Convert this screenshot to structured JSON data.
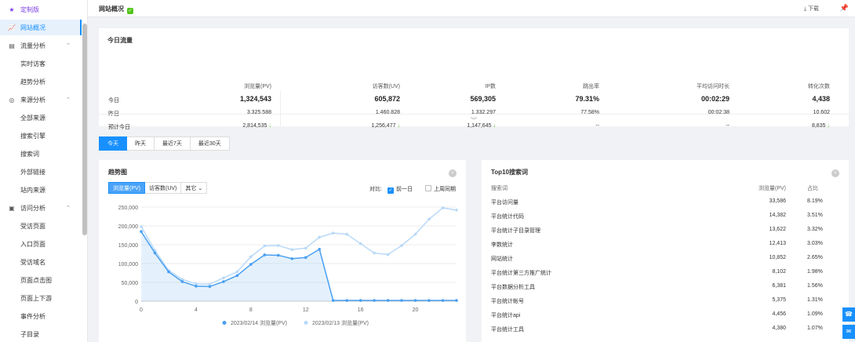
{
  "sidebar": {
    "custom": "定制版",
    "items": [
      {
        "label": "网站概况",
        "icon": "line-chart-icon",
        "type": "top",
        "active": true
      },
      {
        "label": "流量分析",
        "icon": "traffic-icon",
        "type": "group"
      },
      {
        "label": "实时访客",
        "type": "sub"
      },
      {
        "label": "趋势分析",
        "type": "sub"
      },
      {
        "label": "来源分析",
        "icon": "source-icon",
        "type": "group"
      },
      {
        "label": "全部来源",
        "type": "sub"
      },
      {
        "label": "搜索引擎",
        "type": "sub"
      },
      {
        "label": "搜索词",
        "type": "sub"
      },
      {
        "label": "外部链接",
        "type": "sub"
      },
      {
        "label": "站内来源",
        "type": "sub"
      },
      {
        "label": "访问分析",
        "icon": "visit-icon",
        "type": "group"
      },
      {
        "label": "受访页面",
        "type": "sub"
      },
      {
        "label": "入口页面",
        "type": "sub"
      },
      {
        "label": "受访域名",
        "type": "sub"
      },
      {
        "label": "页面点击图",
        "type": "sub"
      },
      {
        "label": "页面上下游",
        "type": "sub"
      },
      {
        "label": "事件分析",
        "type": "sub"
      },
      {
        "label": "子目录",
        "type": "sub"
      }
    ]
  },
  "header": {
    "title": "网站概况",
    "download": "下载"
  },
  "traffic": {
    "title": "今日流量",
    "columns": [
      "浏览量(PV)",
      "访客数(UV)",
      "IP数",
      "跳出率",
      "平均访问时长",
      "转化次数"
    ],
    "rows": [
      {
        "label": "今日",
        "values": [
          "1,324,543",
          "605,872",
          "569,305",
          "79.31%",
          "00:02:29",
          "4,438"
        ]
      },
      {
        "label": "昨日",
        "values": [
          "3,325,588",
          "1,460,828",
          "1,332,297",
          "77.58%",
          "00:02:38",
          "10,602"
        ]
      },
      {
        "label": "预计今日",
        "values": [
          "2,814,535",
          "1,256,477",
          "1,147,645",
          "--",
          "--",
          "8,835"
        ]
      }
    ]
  },
  "tabs": [
    "今天",
    "昨天",
    "最近7天",
    "最近30天"
  ],
  "trend": {
    "title": "趋势图",
    "metrics": [
      "浏览量(PV)",
      "访客数(UV)",
      "其它"
    ],
    "compare_label": "对比:",
    "compare_options": [
      "前一日",
      "上周同期"
    ]
  },
  "chart_data": {
    "type": "line",
    "x": [
      0,
      1,
      2,
      3,
      4,
      5,
      6,
      7,
      8,
      9,
      10,
      11,
      12,
      13,
      14,
      15,
      16,
      17,
      18,
      19,
      20,
      21,
      22,
      23
    ],
    "xticks": [
      0,
      4,
      8,
      12,
      16,
      20
    ],
    "yticks": [
      "0",
      "50,000",
      "100,000",
      "150,000",
      "200,000",
      "250,000"
    ],
    "ylim": [
      0,
      250000
    ],
    "xlim": [
      0,
      23
    ],
    "series": [
      {
        "name": "2023/02/14 浏览量(PV)",
        "color": "#4a9ff0",
        "values": [
          185000,
          128000,
          78000,
          52000,
          40000,
          39000,
          52000,
          68000,
          98000,
          123000,
          122000,
          113000,
          116000,
          138000,
          2000,
          2000,
          2000,
          2000,
          2000,
          2000,
          2000,
          2000,
          2000,
          2000
        ]
      },
      {
        "name": "2023/02/13 浏览量(PV)",
        "color": "#b8d9f8",
        "values": [
          198000,
          135000,
          82000,
          58000,
          46000,
          45000,
          62000,
          78000,
          118000,
          147000,
          148000,
          137000,
          141000,
          170000,
          181000,
          178000,
          153000,
          128000,
          124000,
          148000,
          178000,
          218000,
          248000,
          242000
        ]
      }
    ]
  },
  "top10": {
    "title": "Top10搜索词",
    "headers": [
      "搜索词",
      "浏览量(PV)",
      "占比"
    ],
    "rows": [
      [
        "平台访问量",
        "33,586",
        "8.19%"
      ],
      [
        "平台统计代码",
        "14,382",
        "3.51%"
      ],
      [
        "平台统计子目录管理",
        "13,622",
        "3.32%"
      ],
      [
        "李数统计",
        "12,413",
        "3.03%"
      ],
      [
        "网站统计",
        "10,852",
        "2.65%"
      ],
      [
        "平台统计第三方推广统计",
        "8,102",
        "1.98%"
      ],
      [
        "平台数据分析工具",
        "6,381",
        "1.56%"
      ],
      [
        "平台统计帐号",
        "5,375",
        "1.31%"
      ],
      [
        "平台统计api",
        "4,456",
        "1.09%"
      ],
      [
        "平台统计工具",
        "4,380",
        "1.07%"
      ]
    ]
  }
}
